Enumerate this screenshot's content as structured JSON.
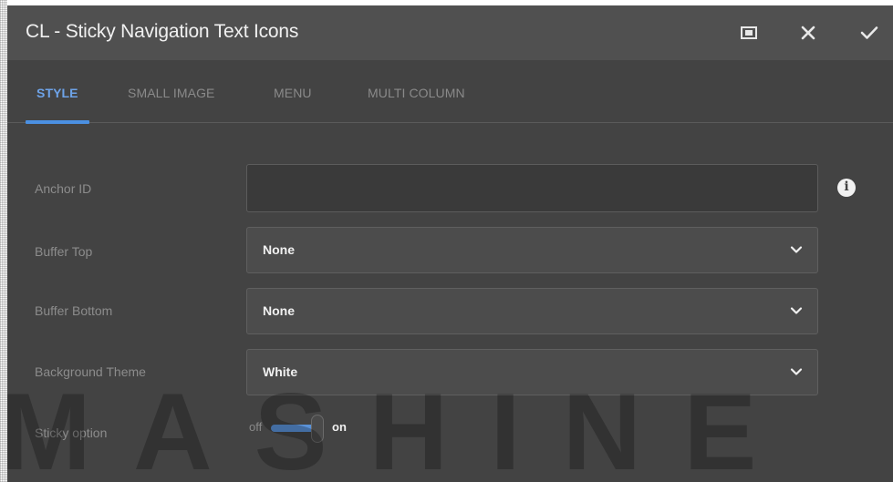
{
  "dialog": {
    "title": "CL - Sticky Navigation Text Icons",
    "buttons": {
      "fullscreen_icon": "fullscreen-icon",
      "close_icon": "close-icon",
      "confirm_icon": "checkmark-icon"
    }
  },
  "tabs": [
    {
      "label": "STYLE",
      "active": true
    },
    {
      "label": "SMALL IMAGE",
      "active": false
    },
    {
      "label": "MENU",
      "active": false
    },
    {
      "label": "MULTI COLUMN",
      "active": false
    }
  ],
  "fields": {
    "anchor_id": {
      "label": "Anchor ID",
      "value": "",
      "info_icon": "info-icon"
    },
    "buffer_top": {
      "label": "Buffer Top",
      "value": "None"
    },
    "buffer_bottom": {
      "label": "Buffer Bottom",
      "value": "None"
    },
    "background_theme": {
      "label": "Background Theme",
      "value": "White"
    },
    "sticky_option": {
      "label": "Sticky option",
      "off_label": "off",
      "on_label": "on",
      "state": "on"
    }
  },
  "watermark": {
    "text": "MASHINE"
  },
  "colors": {
    "accent": "#4b90e2",
    "title_bar": "#505050",
    "panel": "#434343"
  }
}
